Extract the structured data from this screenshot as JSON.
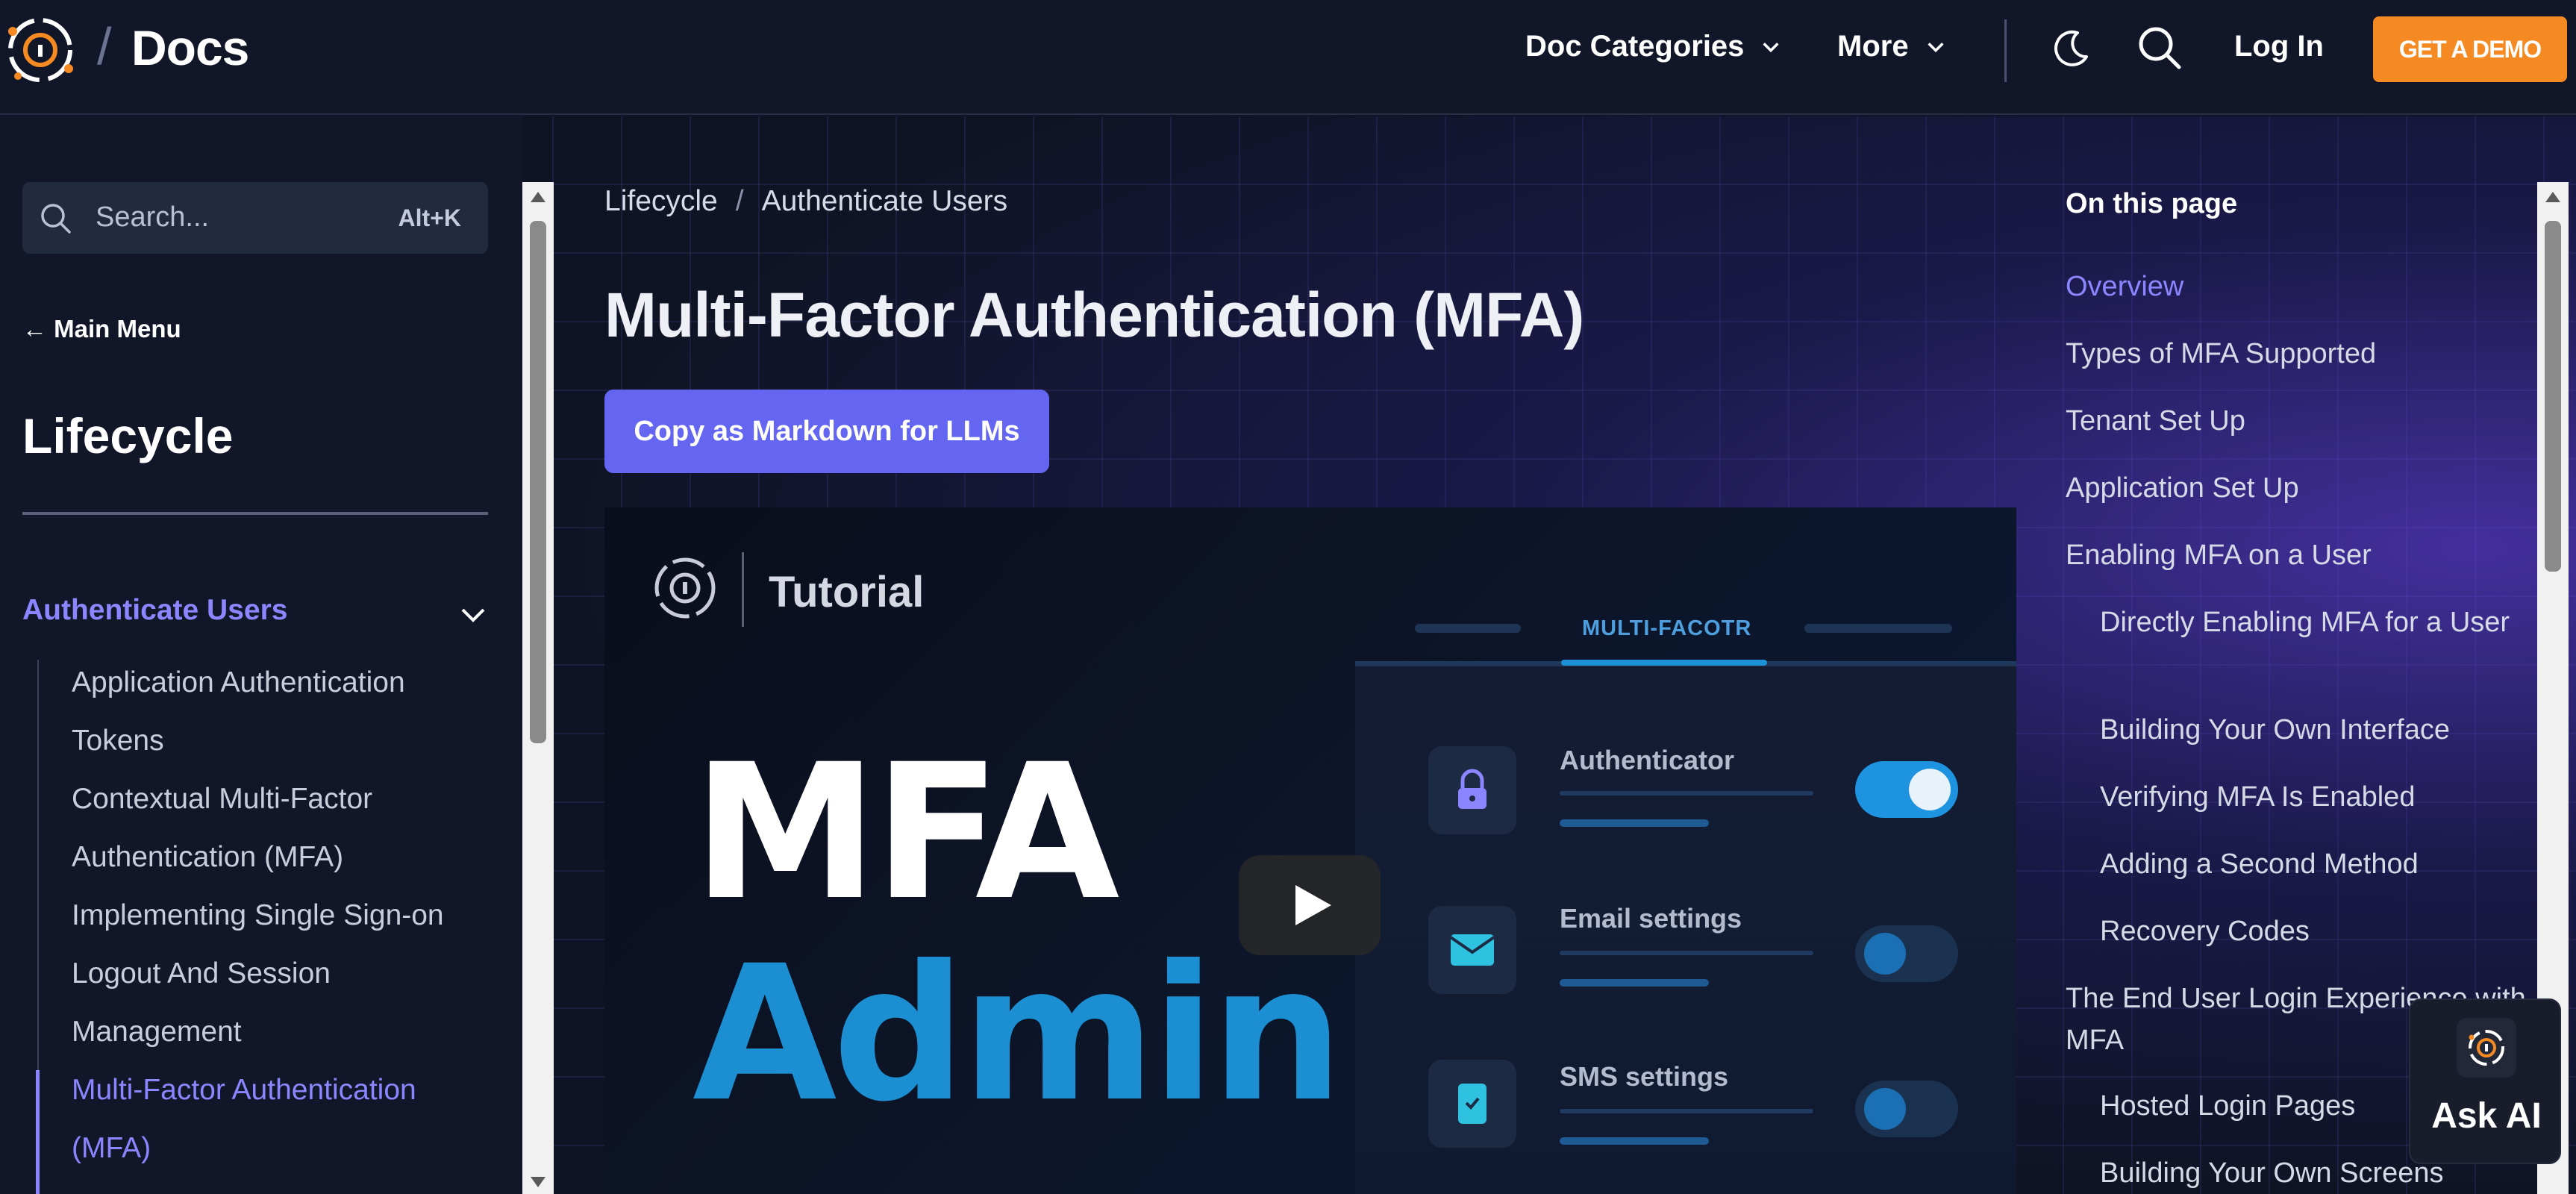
{
  "header": {
    "slash": "/",
    "title": "Docs",
    "nav": [
      {
        "label": "Doc Categories"
      },
      {
        "label": "More"
      }
    ],
    "login_label": "Log In",
    "demo_label": "GET A DEMO",
    "accent": "#f58a22"
  },
  "sidebar": {
    "search_placeholder": "Search...",
    "search_shortcut": "Alt+K",
    "main_menu": "← Main Menu",
    "section_title": "Lifecycle",
    "group_label": "Authenticate Users",
    "links": [
      {
        "label": "Application Authentication Tokens"
      },
      {
        "label": "Contextual Multi-Factor Authentication (MFA)"
      },
      {
        "label": "Implementing Single Sign-on"
      },
      {
        "label": "Logout And Session Management"
      },
      {
        "label": "Multi-Factor Authentication (MFA)"
      }
    ],
    "active_color": "#8b86ff"
  },
  "breadcrumb": {
    "items": [
      "Lifecycle",
      "Authenticate Users"
    ],
    "separator": "/"
  },
  "page": {
    "title": "Multi-Factor Authentication (MFA)",
    "copy_button": "Copy as Markdown for LLMs",
    "button_color": "#6466f1"
  },
  "video": {
    "tutorial_label": "Tutorial",
    "headline_line1": "MFA",
    "headline_line2": "Admin",
    "tab_label": "MULTI-FACOTR",
    "rows": [
      {
        "label": "Authenticator",
        "enabled": true,
        "icon": "lock-icon"
      },
      {
        "label": "Email settings",
        "enabled": false,
        "icon": "mail-icon"
      },
      {
        "label": "SMS settings",
        "enabled": false,
        "icon": "phone-icon"
      }
    ]
  },
  "toc": {
    "title": "On this page",
    "items": [
      {
        "label": "Overview"
      },
      {
        "label": "Types of MFA Supported"
      },
      {
        "label": "Tenant Set Up"
      },
      {
        "label": "Application Set Up"
      },
      {
        "label": "Enabling MFA on a User"
      },
      {
        "label": "Directly Enabling MFA for a User"
      },
      {
        "label": "Building Your Own Interface"
      },
      {
        "label": "Verifying MFA Is Enabled"
      },
      {
        "label": "Adding a Second Method"
      },
      {
        "label": "Recovery Codes"
      },
      {
        "label": "The End User Login Experience with MFA"
      },
      {
        "label": "Hosted Login Pages"
      },
      {
        "label": "Building Your Own Screens"
      }
    ]
  },
  "ask_ai": {
    "label": "Ask AI"
  }
}
